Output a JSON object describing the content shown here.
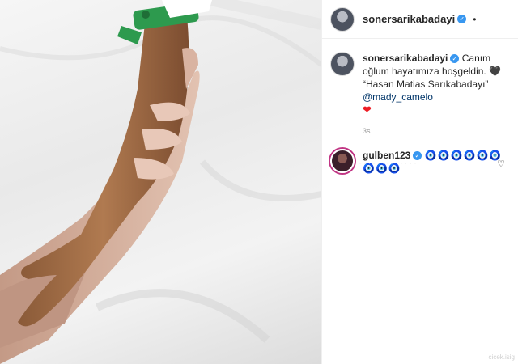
{
  "header": {
    "username": "sonersarikabadayi",
    "separator": "•"
  },
  "post": {
    "caption_user": "sonersarikabadayi",
    "caption_line": "Canım oğlum hayatımıza hoşgeldin.",
    "caption_quote": "“Hasan Matias Sarıkabadayı”",
    "caption_mention": "@mady_camelo",
    "black_heart": "🖤",
    "red_heart": "❤",
    "time": "3s"
  },
  "comment": {
    "username": "gulben123",
    "evil_eyes": "🧿🧿🧿🧿🧿🧿🧿🧿🧿",
    "like_icon": "heart-outline-icon"
  },
  "footer": {
    "faded": "· · · ·  · · ·  · ·  · · · ·",
    "watermark": "cicek.isig"
  },
  "colors": {
    "verified": "#3897f0",
    "mention": "#003569",
    "heart": "#ed1c24",
    "story_ring": "#c13584"
  }
}
